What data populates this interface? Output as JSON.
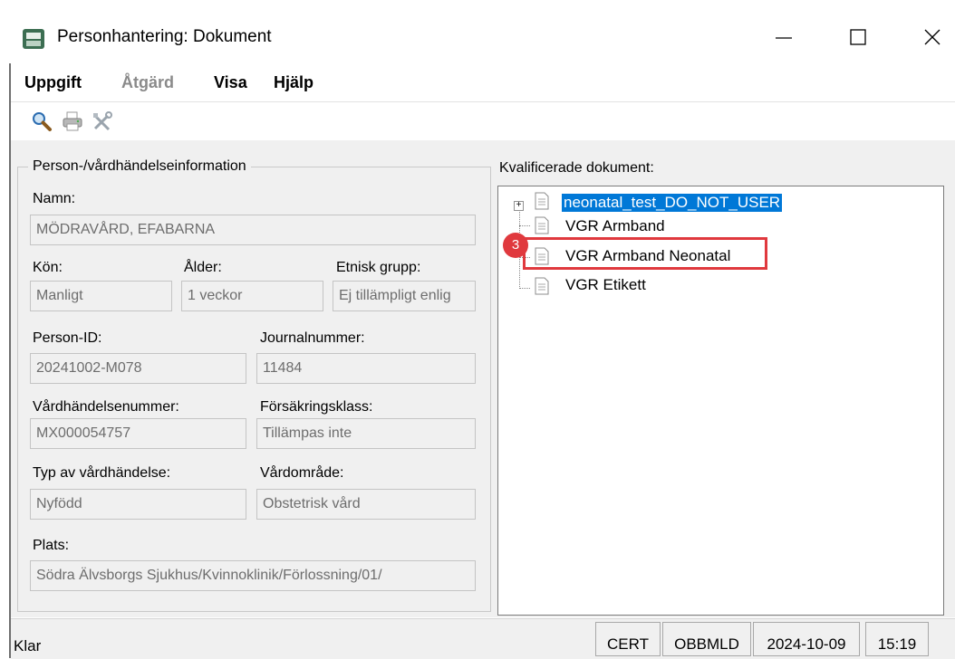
{
  "window": {
    "title": "Personhantering: Dokument",
    "controls": {
      "minimize": "—",
      "maximize": "☐",
      "close": "✕"
    }
  },
  "menu": {
    "items": [
      {
        "label": "Uppgift",
        "enabled": true
      },
      {
        "label": "Åtgärd",
        "enabled": false
      },
      {
        "label": "Visa",
        "enabled": true
      },
      {
        "label": "Hjälp",
        "enabled": true
      }
    ]
  },
  "toolbar": {
    "icons": [
      "search-icon",
      "printer-icon",
      "tools-icon"
    ]
  },
  "info": {
    "group_title": "Person-/vårdhändelseinformation",
    "name_label": "Namn:",
    "name_value": "MÖDRAVÅRD, EFABARNA",
    "gender_label": "Kön:",
    "gender_value": "Manligt",
    "age_label": "Ålder:",
    "age_value": "1 veckor",
    "ethnic_label": "Etnisk grupp:",
    "ethnic_value": "Ej tillämpligt enlig",
    "person_id_label": "Person-ID:",
    "person_id_value": "20241002-M078",
    "journal_label": "Journalnummer:",
    "journal_value": "11484",
    "event_no_label": "Vårdhändelsenummer:",
    "event_no_value": "MX000054757",
    "insurance_label": "Försäkringsklass:",
    "insurance_value": "Tillämpas inte",
    "event_type_label": "Typ av vårdhändelse:",
    "event_type_value": "Nyfödd",
    "care_area_label": "Vårdområde:",
    "care_area_value": "Obstetrisk vård",
    "place_label": "Plats:",
    "place_value": "Södra Älvsborgs Sjukhus/Kvinnoklinik/Förlossning/01/"
  },
  "documents": {
    "label": "Kvalificerade dokument:",
    "items": [
      {
        "label": "neonatal_test_DO_NOT_USER",
        "selected": true,
        "expandable": true
      },
      {
        "label": "VGR Armband",
        "selected": false,
        "expandable": false
      },
      {
        "label": "VGR Armband Neonatal",
        "selected": false,
        "expandable": false
      },
      {
        "label": "VGR Etikett",
        "selected": false,
        "expandable": false
      }
    ],
    "expander_symbol": "+"
  },
  "annotation": {
    "step_number": "3",
    "color": "#e0393e"
  },
  "status": {
    "text": "Klar",
    "cells": [
      "CERT",
      "OBBMLD",
      "2024-10-09",
      "15:19"
    ]
  }
}
